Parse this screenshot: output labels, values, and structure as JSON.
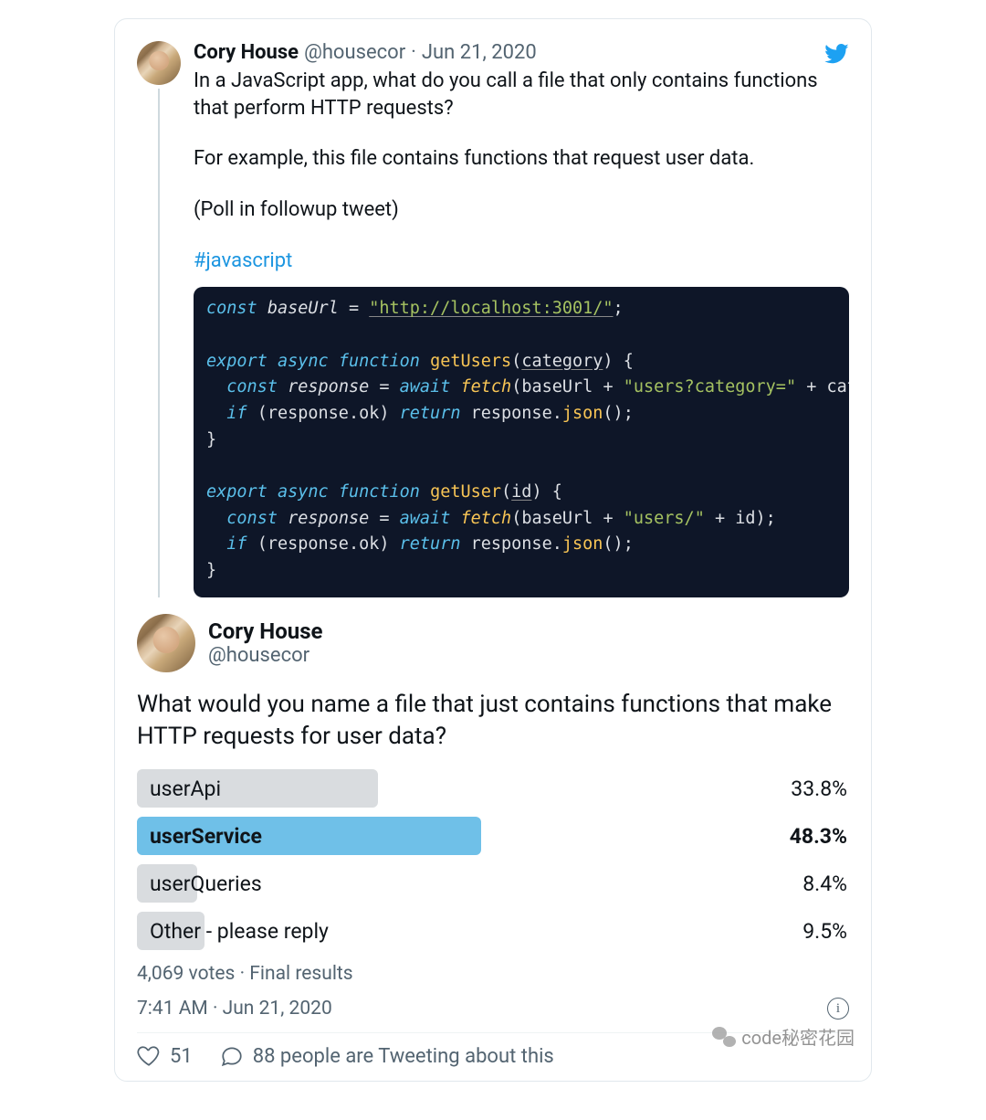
{
  "tweet1": {
    "author_name": "Cory House",
    "author_handle": "@housecor",
    "date": "Jun 21, 2020",
    "paras": [
      "In a JavaScript app, what do you call a file that only contains functions that perform HTTP requests?",
      "For example, this file contains functions that request user data.",
      "(Poll in followup tweet)"
    ],
    "hashtag": "#javascript",
    "code": {
      "baseUrl": "\"http://localhost:3001/\"",
      "fn1": "getUsers",
      "fn1_param": "category",
      "fn1_path": "\"users?category=\"",
      "fn2": "getUser",
      "fn2_param": "id",
      "fn2_path": "\"users/\""
    }
  },
  "tweet2": {
    "author_name": "Cory House",
    "author_handle": "@housecor",
    "text": "What would you name a file that just contains functions that make HTTP requests for user data?",
    "poll_meta": "4,069 votes · Final results",
    "timestamp": "7:41 AM · Jun 21, 2020"
  },
  "actions": {
    "likes": "51",
    "reply_text": "88 people are Tweeting about this"
  },
  "watermark": "code秘密花园",
  "chart_data": {
    "type": "bar",
    "title": "What would you name a file that just contains functions that make HTTP requests for user data?",
    "categories": [
      "userApi",
      "userService",
      "userQueries",
      "Other - please reply"
    ],
    "values": [
      33.8,
      48.3,
      8.4,
      9.5
    ],
    "winner_index": 1,
    "votes": 4069,
    "xlabel": "",
    "ylabel": "%",
    "ylim": [
      0,
      100
    ]
  }
}
